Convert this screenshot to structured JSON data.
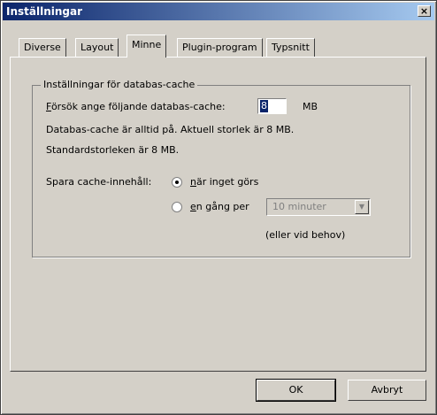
{
  "window": {
    "title": "Inställningar",
    "close_symbol": "×"
  },
  "tabs": [
    {
      "label": "Diverse",
      "active": false
    },
    {
      "label": "Layout",
      "active": false
    },
    {
      "label": "Minne",
      "active": true
    },
    {
      "label": "Plugin-program",
      "active": false
    },
    {
      "label": "Typsnitt",
      "active": false
    }
  ],
  "group": {
    "label": "Inställningar för databas-cache",
    "cache_prompt_key": "F",
    "cache_prompt_rest": "örsök ange följande databas-cache:",
    "cache_value": "8",
    "cache_unit": "MB",
    "info_line1": "Databas-cache är alltid på.  Aktuell storlek är 8 MB.",
    "info_line2": "Standardstorleken är 8 MB.",
    "save_label": "Spara cache-innehåll:",
    "radio_idle_key": "n",
    "radio_idle_rest": "är inget görs",
    "radio_interval_key": "e",
    "radio_interval_rest": "n gång per",
    "interval_value": "10 minuter",
    "on_demand_note": "(eller vid behov)"
  },
  "buttons": {
    "ok": "OK",
    "cancel": "Avbryt"
  },
  "colors": {
    "titlebar_start": "#0a246a",
    "titlebar_end": "#a6caf0",
    "face": "#d4d0c8"
  }
}
